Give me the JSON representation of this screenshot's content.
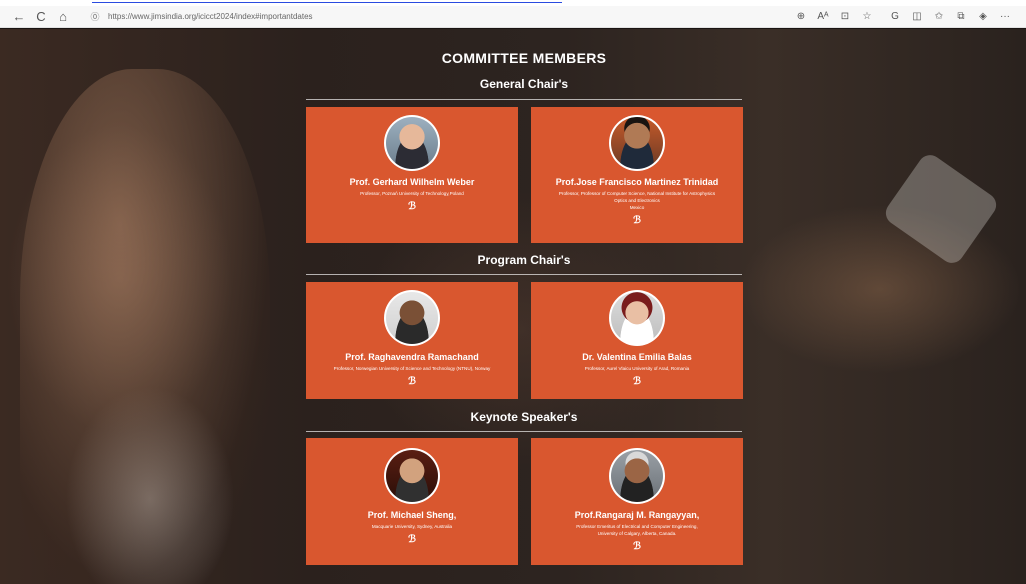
{
  "browser": {
    "url": "https://www.jimsindia.org/icicct2024/index#importantdates",
    "nav_icons": [
      "back-icon",
      "refresh-icon",
      "home-icon"
    ],
    "nav_glyphs": {
      "back": "←",
      "refresh": "C",
      "home": "⌂"
    },
    "tool_glyphs": {
      "zoom": "⊕",
      "read_aloud": "Aᴬ",
      "immersive": "⊡",
      "favorite": "☆",
      "extension": "G",
      "split": "◫",
      "favorites_bar": "✩",
      "collections": "⧉",
      "shield": "◈",
      "more": "···"
    },
    "lock_glyph": "⓪"
  },
  "page": {
    "title": "COMMITTEE MEMBERS",
    "sections": [
      {
        "heading": "General Chair's",
        "members": [
          {
            "name": "Prof. Gerhard Wilhelm Weber",
            "affiliation": [
              "Professor, Poznań University of Technology,Poland"
            ]
          },
          {
            "name": "Prof.Jose Francisco Martinez Trinidad",
            "affiliation": [
              "Professor, Professor of Computer Science, National Institute for Astrophysics",
              "Optics and Electronics",
              "Mexico"
            ]
          }
        ]
      },
      {
        "heading": "Program Chair's",
        "members": [
          {
            "name": "Prof. Raghavendra Ramachand",
            "affiliation": [
              "Professor, Norwegian University of Science and Technology (NTNU), Norway"
            ]
          },
          {
            "name": "Dr. Valentina Emilia Balas",
            "affiliation": [
              "Professor, Aurel Vlaicu University of Arad, Romania"
            ]
          }
        ]
      },
      {
        "heading": "Keynote Speaker's",
        "members": [
          {
            "name": "Prof. Michael Sheng,",
            "affiliation": [
              "Macquarie University, Sydney, Australia"
            ]
          },
          {
            "name": "Prof.Rangaraj M. Rangayyan,",
            "affiliation": [
              "Professor Emeritus of Electrical and Computer Engineering,",
              "University of Calgary, Alberta, Canada."
            ]
          }
        ]
      }
    ],
    "signature_glyph": "ℬ",
    "colors": {
      "card": "#d9572f",
      "text": "#ffffff",
      "link_underline": "#2a4be0"
    }
  }
}
